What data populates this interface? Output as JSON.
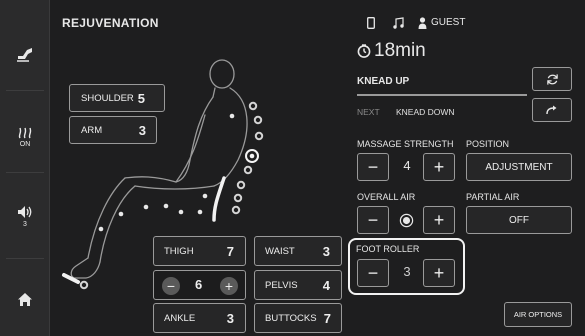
{
  "header": {
    "title": "REJUVENATION",
    "user_label": "GUEST"
  },
  "sidebar": {
    "heat_status": "ON",
    "volume_level": "3"
  },
  "program": {
    "timer": "18min",
    "current": "KNEAD UP",
    "next_label": "NEXT",
    "next_value": "KNEAD DOWN"
  },
  "intensity": {
    "shoulder": {
      "label": "SHOULDER",
      "value": "5"
    },
    "arm": {
      "label": "ARM",
      "value": "3"
    },
    "thigh": {
      "label": "THIGH",
      "value": "7"
    },
    "calf": {
      "value": "6"
    },
    "ankle": {
      "label": "ANKLE",
      "value": "3"
    },
    "waist": {
      "label": "WAIST",
      "value": "3"
    },
    "pelvis": {
      "label": "PELVIS",
      "value": "4"
    },
    "buttocks": {
      "label": "BUTTOCKS",
      "value": "7"
    }
  },
  "controls": {
    "massage_strength": {
      "label": "MASSAGE STRENGTH",
      "value": "4"
    },
    "position": {
      "label": "POSITION",
      "button": "ADJUSTMENT"
    },
    "overall_air": {
      "label": "OVERALL AIR"
    },
    "partial_air": {
      "label": "PARTIAL AIR",
      "button": "OFF"
    },
    "foot_roller": {
      "label": "FOOT ROLLER",
      "value": "3"
    },
    "air_options": "AIR OPTIONS",
    "minus": "−",
    "plus": "+"
  }
}
